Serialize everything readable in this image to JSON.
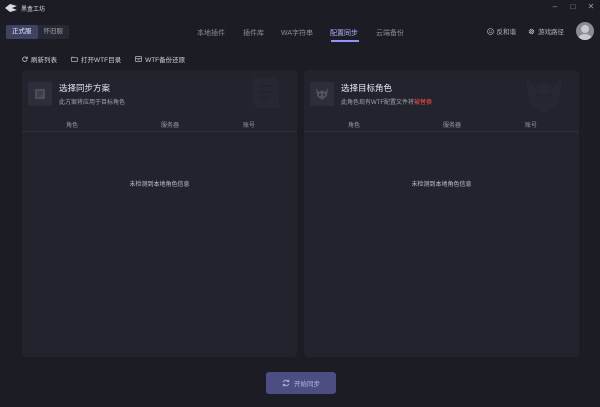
{
  "window": {
    "title": "黑盒工坊",
    "controls": [
      "–",
      "□",
      "✕"
    ]
  },
  "header": {
    "server_toggle": [
      {
        "label": "正式服",
        "active": true
      },
      {
        "label": "怀旧服",
        "active": false
      }
    ],
    "nav": [
      {
        "label": "本地插件",
        "active": false
      },
      {
        "label": "插件库",
        "active": false
      },
      {
        "label": "WA字符串",
        "active": false
      },
      {
        "label": "配置同步",
        "active": true
      },
      {
        "label": "云端备份",
        "active": false
      }
    ],
    "feedback_label": "反和谐",
    "game_path_label": "游戏路径"
  },
  "toolbar": {
    "refresh_label": "刷新列表",
    "open_wtf_label": "打开WTF目录",
    "restore_wtf_label": "WTF备份还原"
  },
  "source_panel": {
    "title": "选择同步方案",
    "desc": "此方案将应用于目标角色",
    "columns": [
      "角色",
      "服务器",
      "账号"
    ],
    "empty_text": "未检测到本地角色信息"
  },
  "target_panel": {
    "title": "选择目标角色",
    "desc_prefix": "此角色现有WTF配置文件将",
    "desc_warn": "被替换",
    "columns": [
      "角色",
      "服务器",
      "账号"
    ],
    "empty_text": "未检测到本地角色信息"
  },
  "actions": {
    "start_sync_label": "开始同步"
  },
  "colors": {
    "background": "#1b1c24",
    "panel": "#22232d",
    "accent": "#8f95ff",
    "warn": "#ff4b4b",
    "primary_button": "#4c4e83"
  }
}
